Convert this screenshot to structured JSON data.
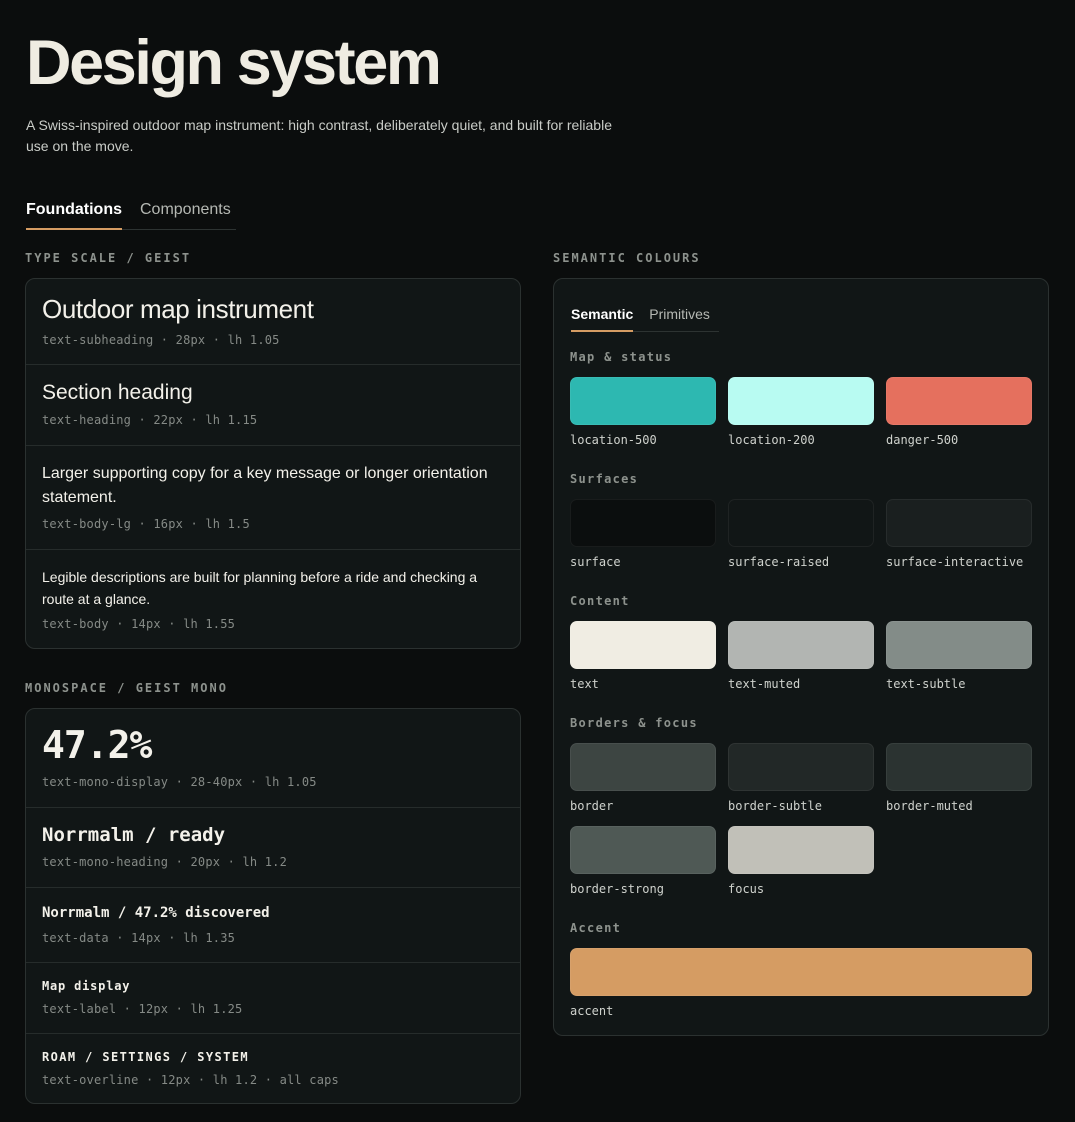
{
  "header": {
    "title": "Design system",
    "intro": "A Swiss-inspired outdoor map instrument: high contrast, deliberately quiet, and built for reliable use on the move."
  },
  "tabs": {
    "foundations": "Foundations",
    "components": "Components"
  },
  "type_scale": {
    "overline": "TYPE SCALE / GEIST",
    "rows": [
      {
        "sample": "Outdoor map instrument",
        "spec": "text-subheading · 28px · lh 1.05"
      },
      {
        "sample": "Section heading",
        "spec": "text-heading · 22px · lh 1.15"
      },
      {
        "sample": "Larger supporting copy for a key message or longer orientation statement.",
        "spec": "text-body-lg · 16px · lh 1.5"
      },
      {
        "sample": "Legible descriptions are built for planning before a ride and checking a route at a glance.",
        "spec": "text-body · 14px · lh 1.55"
      }
    ]
  },
  "monospace": {
    "overline": "MONOSPACE / GEIST MONO",
    "rows": [
      {
        "sample": "47.2%",
        "spec": "text-mono-display · 28-40px · lh 1.05"
      },
      {
        "sample": "Norrmalm / ready",
        "spec": "text-mono-heading · 20px · lh 1.2"
      },
      {
        "sample": "Norrmalm / 47.2% discovered",
        "spec": "text-data · 14px · lh 1.35"
      },
      {
        "sample": "Map display",
        "spec": "text-label · 12px · lh 1.25"
      },
      {
        "sample": "ROAM / SETTINGS / SYSTEM",
        "spec": "text-overline · 12px · lh 1.2 · all caps"
      }
    ]
  },
  "semantic": {
    "overline": "SEMANTIC COLOURS",
    "tabs": {
      "semantic": "Semantic",
      "primitives": "Primitives"
    },
    "groups": [
      {
        "title": "Map & status",
        "swatches": [
          {
            "label": "location-500",
            "color": "#2db8b1"
          },
          {
            "label": "location-200",
            "color": "#b8fbf2"
          },
          {
            "label": "danger-500",
            "color": "#e5705e"
          }
        ]
      },
      {
        "title": "Surfaces",
        "swatches": [
          {
            "label": "surface",
            "color": "#0b0e0e"
          },
          {
            "label": "surface-raised",
            "color": "#111616"
          },
          {
            "label": "surface-interactive",
            "color": "#1a1f1f"
          }
        ]
      },
      {
        "title": "Content",
        "swatches": [
          {
            "label": "text",
            "color": "#f0ede3"
          },
          {
            "label": "text-muted",
            "color": "#b2b5b2"
          },
          {
            "label": "text-subtle",
            "color": "#838c88"
          }
        ]
      },
      {
        "title": "Borders & focus",
        "swatches": [
          {
            "label": "border",
            "color": "#3d4542"
          },
          {
            "label": "border-subtle",
            "color": "#222827"
          },
          {
            "label": "border-muted",
            "color": "#2b3331"
          },
          {
            "label": "border-strong",
            "color": "#4f5955"
          },
          {
            "label": "focus",
            "color": "#c1c0b8"
          }
        ]
      },
      {
        "title": "Accent",
        "swatches": [
          {
            "label": "accent",
            "color": "#d59c63"
          }
        ]
      }
    ]
  }
}
